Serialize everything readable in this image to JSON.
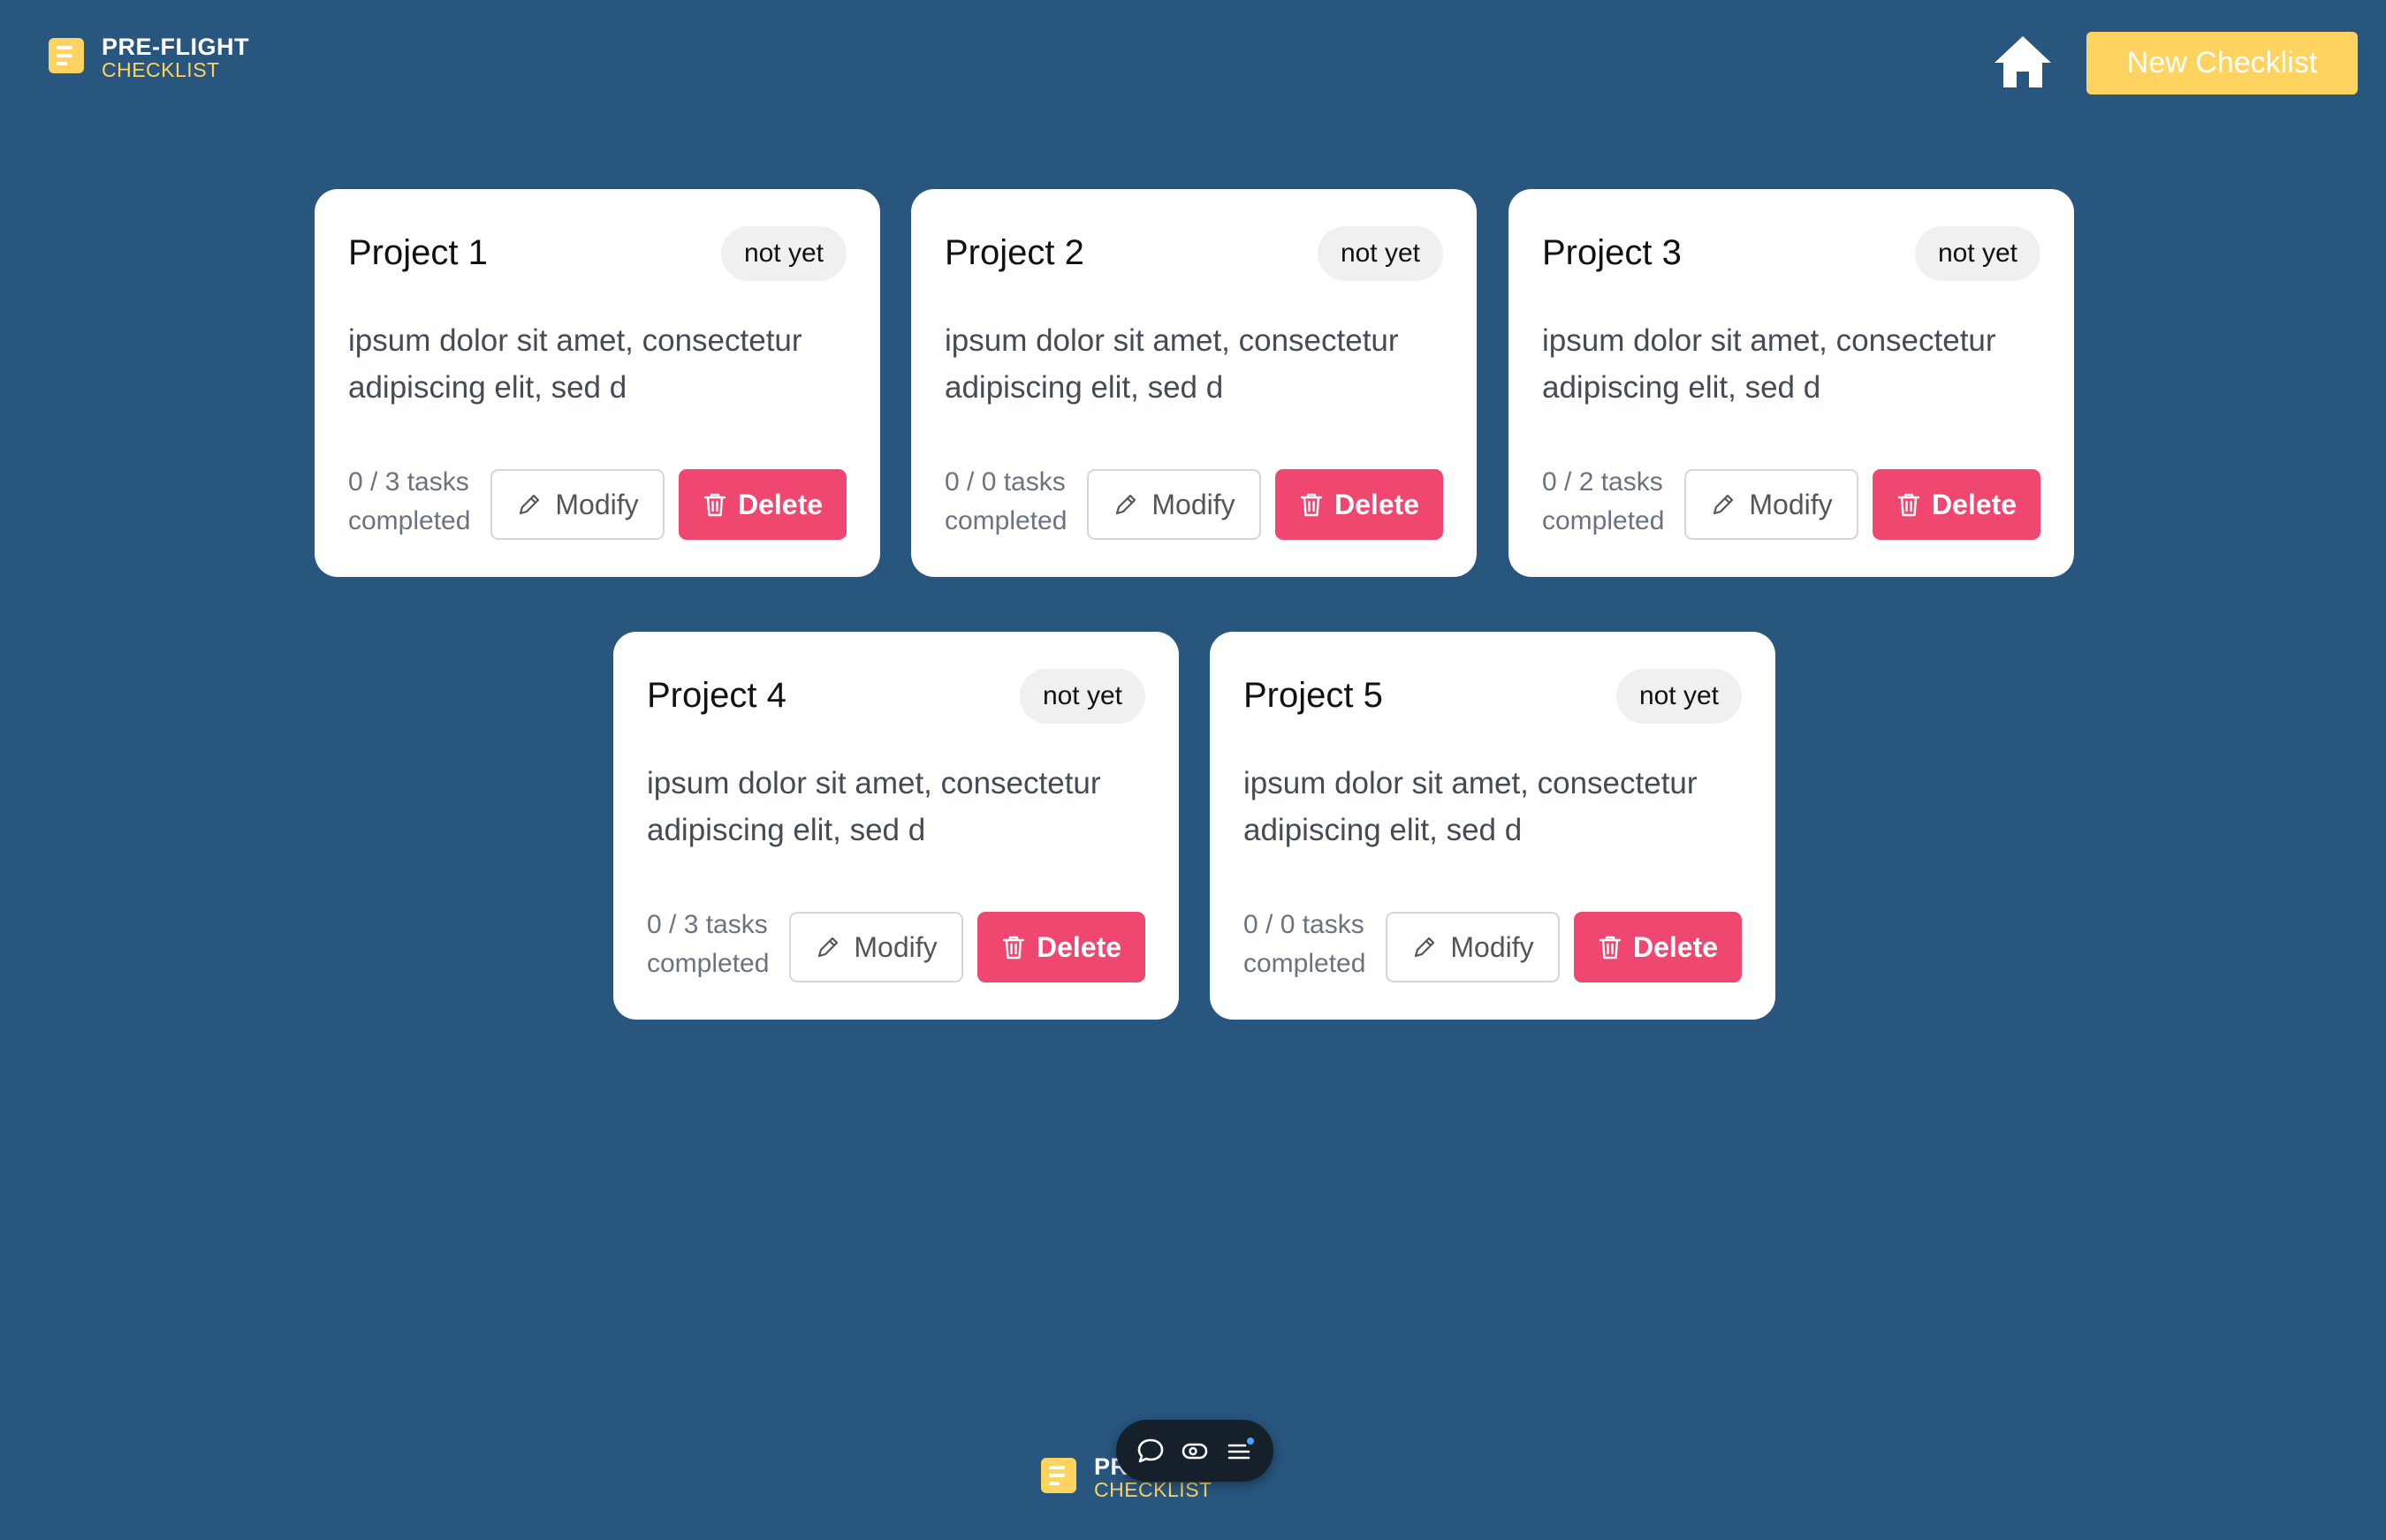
{
  "header": {
    "logo_title": "PRE-FLIGHT",
    "logo_subtitle": "CHECKLIST",
    "new_button_label": "New Checklist"
  },
  "projects": [
    {
      "title": "Project 1",
      "status": "not yet",
      "description": "ipsum dolor sit amet, consectetur adipiscing elit, sed d",
      "tasks": "0 / 3 tasks completed",
      "modify_label": "Modify",
      "delete_label": "Delete"
    },
    {
      "title": "Project 2",
      "status": "not yet",
      "description": "ipsum dolor sit amet, consectetur adipiscing elit, sed d",
      "tasks": "0 / 0 tasks completed",
      "modify_label": "Modify",
      "delete_label": "Delete"
    },
    {
      "title": "Project 3",
      "status": "not yet",
      "description": "ipsum dolor sit amet, consectetur adipiscing elit, sed d",
      "tasks": "0 / 2 tasks completed",
      "modify_label": "Modify",
      "delete_label": "Delete"
    },
    {
      "title": "Project 4",
      "status": "not yet",
      "description": "ipsum dolor sit amet, consectetur adipiscing elit, sed d",
      "tasks": "0 / 3 tasks completed",
      "modify_label": "Modify",
      "delete_label": "Delete"
    },
    {
      "title": "Project 5",
      "status": "not yet",
      "description": "ipsum dolor sit amet, consectetur adipiscing elit, sed d",
      "tasks": "0 / 0 tasks completed",
      "modify_label": "Modify",
      "delete_label": "Delete"
    }
  ],
  "footer": {
    "logo_title": "PRE-FLIGHT",
    "logo_subtitle": "CHECKLIST",
    "toolbar_icons": [
      "comment-icon",
      "toggle-icon",
      "menu-icon"
    ]
  },
  "colors": {
    "background": "#28567e",
    "accent": "#ffd35f",
    "danger": "#ef4770",
    "card": "#ffffff"
  }
}
